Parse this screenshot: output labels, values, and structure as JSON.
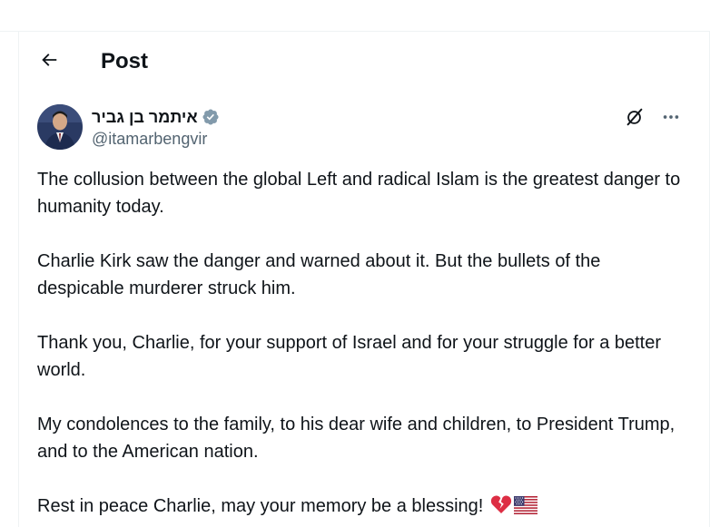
{
  "header": {
    "title": "Post",
    "back_icon": "arrow-left-icon"
  },
  "post": {
    "display_name": "איתמר בן גביר",
    "handle": "@itamarbengvir",
    "verified_color": "#829aab",
    "body": [
      "The collusion between the global Left and radical Islam is the greatest danger to humanity today.",
      "Charlie Kirk saw the danger and warned about it. But the bullets of the despicable murderer struck him.",
      "Thank you, Charlie, for your support of Israel and for your struggle for a better world.",
      "My condolences to the family, to his dear wife and children, to President Trump, and to the American nation.",
      "Rest in peace Charlie, may your memory be a blessing!"
    ],
    "emojis": [
      "broken-heart-icon",
      "us-flag-icon"
    ],
    "actions": [
      "grok-icon",
      "more-icon"
    ]
  },
  "colors": {
    "text": "#0f1419",
    "secondary": "#536471",
    "border": "#eff3f4"
  }
}
